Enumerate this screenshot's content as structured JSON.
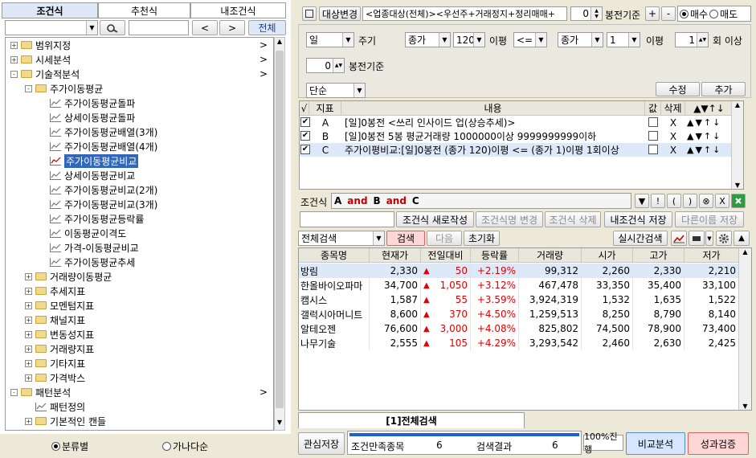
{
  "left": {
    "tabs": [
      "조건식",
      "추천식",
      "내조건식"
    ],
    "search_placeholder": "",
    "nav_prev": "<",
    "nav_next": ">",
    "all_button": "전체",
    "tree": [
      {
        "label": "범위지정",
        "level": 0,
        "kind": "folder",
        "expander": "+",
        "arrow": ">"
      },
      {
        "label": "시세분석",
        "level": 0,
        "kind": "folder",
        "expander": "+",
        "arrow": ">"
      },
      {
        "label": "기술적분석",
        "level": 0,
        "kind": "folder",
        "expander": "-",
        "arrow": ">"
      },
      {
        "label": "주가이동평균",
        "level": 1,
        "kind": "folder",
        "expander": "-",
        "arrow": ""
      },
      {
        "label": "주가이동평균돌파",
        "level": 2,
        "kind": "item",
        "expander": "",
        "arrow": ""
      },
      {
        "label": "상세이동평균돌파",
        "level": 2,
        "kind": "item",
        "expander": "",
        "arrow": ""
      },
      {
        "label": "주가이동평균배열(3개)",
        "level": 2,
        "kind": "item",
        "expander": "",
        "arrow": ""
      },
      {
        "label": "주가이동평균배열(4개)",
        "level": 2,
        "kind": "item",
        "expander": "",
        "arrow": ""
      },
      {
        "label": "주가이동평균비교",
        "level": 2,
        "kind": "item",
        "expander": "",
        "arrow": "",
        "selected": true
      },
      {
        "label": "상세이동평균비교",
        "level": 2,
        "kind": "item",
        "expander": "",
        "arrow": ""
      },
      {
        "label": "주가이동평균비교(2개)",
        "level": 2,
        "kind": "item",
        "expander": "",
        "arrow": ""
      },
      {
        "label": "주가이동평균비교(3개)",
        "level": 2,
        "kind": "item",
        "expander": "",
        "arrow": ""
      },
      {
        "label": "주가이동평균등락률",
        "level": 2,
        "kind": "item",
        "expander": "",
        "arrow": ""
      },
      {
        "label": "이동평균이격도",
        "level": 2,
        "kind": "item",
        "expander": "",
        "arrow": ""
      },
      {
        "label": "가격-이동평균비교",
        "level": 2,
        "kind": "item",
        "expander": "",
        "arrow": ""
      },
      {
        "label": "주가이동평균추세",
        "level": 2,
        "kind": "item",
        "expander": "",
        "arrow": ""
      },
      {
        "label": "거래량이동평균",
        "level": 1,
        "kind": "folder",
        "expander": "+",
        "arrow": ""
      },
      {
        "label": "추세지표",
        "level": 1,
        "kind": "folder",
        "expander": "+",
        "arrow": ""
      },
      {
        "label": "모멘텀지표",
        "level": 1,
        "kind": "folder",
        "expander": "+",
        "arrow": ""
      },
      {
        "label": "채널지표",
        "level": 1,
        "kind": "folder",
        "expander": "+",
        "arrow": ""
      },
      {
        "label": "변동성지표",
        "level": 1,
        "kind": "folder",
        "expander": "+",
        "arrow": ""
      },
      {
        "label": "거래량지표",
        "level": 1,
        "kind": "folder",
        "expander": "+",
        "arrow": ""
      },
      {
        "label": "기타지표",
        "level": 1,
        "kind": "folder",
        "expander": "+",
        "arrow": ""
      },
      {
        "label": "가격박스",
        "level": 1,
        "kind": "folder",
        "expander": "+",
        "arrow": ""
      },
      {
        "label": "패턴분석",
        "level": 0,
        "kind": "folder",
        "expander": "-",
        "arrow": ">"
      },
      {
        "label": "패턴정의",
        "level": 1,
        "kind": "item",
        "expander": "",
        "arrow": ""
      },
      {
        "label": "기본적인 캔들",
        "level": 1,
        "kind": "folder",
        "expander": "+",
        "arrow": ""
      }
    ],
    "radio_category": "분류별",
    "radio_alpha": "가나다순"
  },
  "top": {
    "target_button": "대상변경",
    "target_text": "<업종대상(전체)><우선주+거래정지+정리매매+",
    "offset_value": "0",
    "offset_label": "봉전기준",
    "plus": "+",
    "minus": "-",
    "radio_buy": "매수",
    "radio_sell": "매도"
  },
  "condition": {
    "period": "일",
    "period_label": "주기",
    "field1": "종가",
    "field1_n": "120",
    "field1_suffix": "이평",
    "operator": "<=",
    "field2": "종가",
    "field2_n": "1",
    "field2_suffix": "이평",
    "count_value": "1",
    "count_label": "회 이상",
    "bar_offset_value": "0",
    "bar_offset_label": "봉전기준",
    "mode": "단순",
    "modify_button": "수정",
    "add_button": "추가"
  },
  "indicators": {
    "headers": [
      "√",
      "지표",
      "내용",
      "값",
      "삭제",
      "▲▼↑↓"
    ],
    "rows": [
      {
        "checked": true,
        "id": "A",
        "content": "[일]0봉전 <쓰리 인사이드 업(상승추세)>",
        "del": "X",
        "arrows": "▲▼↑↓"
      },
      {
        "checked": true,
        "id": "B",
        "content": "[일]0봉전 5봉 평균거래량 1000000이상 9999999999이하",
        "del": "X",
        "arrows": "▲▼↑↓"
      },
      {
        "checked": true,
        "id": "C",
        "content": "주가이평비교:[일]0봉전 (종가 120)이평 <= (종가 1)이평 1회이상",
        "del": "X",
        "arrows": "▲▼↑↓"
      }
    ]
  },
  "formula": {
    "label": "조건식",
    "tokens": [
      {
        "text": "A",
        "op": false
      },
      {
        "text": "and",
        "op": true
      },
      {
        "text": "B",
        "op": false
      },
      {
        "text": "and",
        "op": true
      },
      {
        "text": "C",
        "op": false
      }
    ],
    "tools": [
      "▼",
      "!",
      "(",
      ")",
      "⊗",
      "X",
      "?"
    ]
  },
  "actions": {
    "name_input": "",
    "new": "조건식 새로작성",
    "rename": "조건식명 변경",
    "delete": "조건식 삭제",
    "save": "내조건식 저장",
    "save_as": "다른이름 저장"
  },
  "search": {
    "mode": "전체검색",
    "search": "검색",
    "next": "다음",
    "reset": "초기화",
    "realtime": "실시간검색"
  },
  "results": {
    "headers": [
      "종목명",
      "현재가",
      "전일대비",
      "등락률",
      "거래량",
      "시가",
      "고가",
      "저가"
    ],
    "rows": [
      {
        "name": "방림",
        "price": "2,330",
        "change": "50",
        "rate": "+2.19%",
        "volume": "99,312",
        "open": "2,260",
        "high": "2,330",
        "low": "2,210"
      },
      {
        "name": "한올바이오파마",
        "price": "34,700",
        "change": "1,050",
        "rate": "+3.12%",
        "volume": "467,478",
        "open": "33,350",
        "high": "35,400",
        "low": "33,100"
      },
      {
        "name": "캠시스",
        "price": "1,587",
        "change": "55",
        "rate": "+3.59%",
        "volume": "3,924,319",
        "open": "1,532",
        "high": "1,635",
        "low": "1,522"
      },
      {
        "name": "갤럭시아머니트",
        "price": "8,600",
        "change": "370",
        "rate": "+4.50%",
        "volume": "1,259,513",
        "open": "8,250",
        "high": "8,790",
        "low": "8,140"
      },
      {
        "name": "알테오젠",
        "price": "76,600",
        "change": "3,000",
        "rate": "+4.08%",
        "volume": "825,802",
        "open": "74,500",
        "high": "78,900",
        "low": "73,400"
      },
      {
        "name": "나무기술",
        "price": "2,555",
        "change": "105",
        "rate": "+4.29%",
        "volume": "3,293,542",
        "open": "2,460",
        "high": "2,630",
        "low": "2,425"
      }
    ]
  },
  "bottom": {
    "tab": "[1]전체검색",
    "watch_save": "관심저장",
    "match_label": "조건만족종목",
    "match_value": "6",
    "result_label": "검색결과",
    "result_value": "6",
    "progress_label": "100%진행",
    "progress": 1.0,
    "compare": "비교분석",
    "verify": "성과검증"
  },
  "colors": {
    "up": "#e00000",
    "selected": "#3166b8",
    "row_highlight": "#dde9f8",
    "search_btn": "#ffd6d6"
  }
}
